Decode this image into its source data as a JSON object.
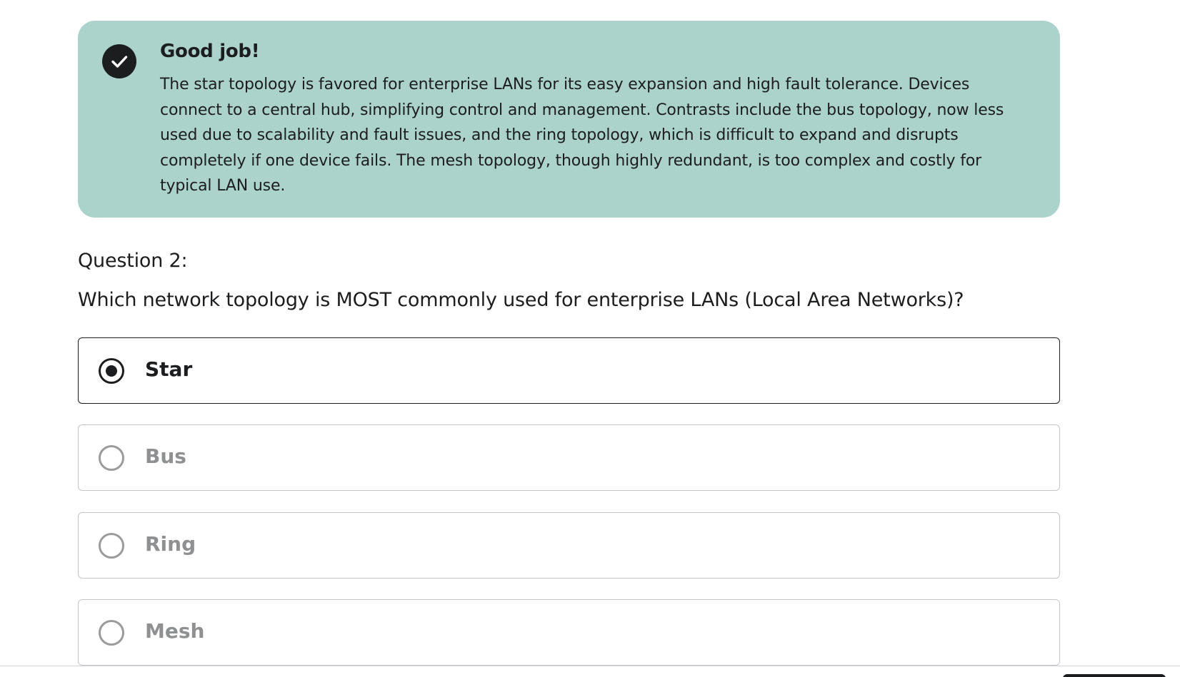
{
  "feedback": {
    "title": "Good job!",
    "body": "The star topology is favored for enterprise LANs for its easy expansion and high fault tolerance. Devices connect to a central hub, simplifying control and management. Contrasts include the bus topology, now less used due to scalability and fault issues, and the ring topology, which is difficult to expand and disrupts completely if one device fails. The mesh topology, though highly redundant, is too complex and costly for typical LAN use.",
    "icon": "check-circle-icon",
    "background_color": "#acd2cc"
  },
  "question": {
    "label": "Question 2:",
    "text": "Which network topology is MOST commonly used for enterprise LANs (Local Area Networks)?"
  },
  "options": [
    {
      "label": "Star",
      "selected": true
    },
    {
      "label": "Bus",
      "selected": false
    },
    {
      "label": "Ring",
      "selected": false
    },
    {
      "label": "Mesh",
      "selected": false
    }
  ],
  "colors": {
    "text": "#1c1d1f",
    "muted_text": "#8f9091",
    "border": "#c4c5c7"
  }
}
